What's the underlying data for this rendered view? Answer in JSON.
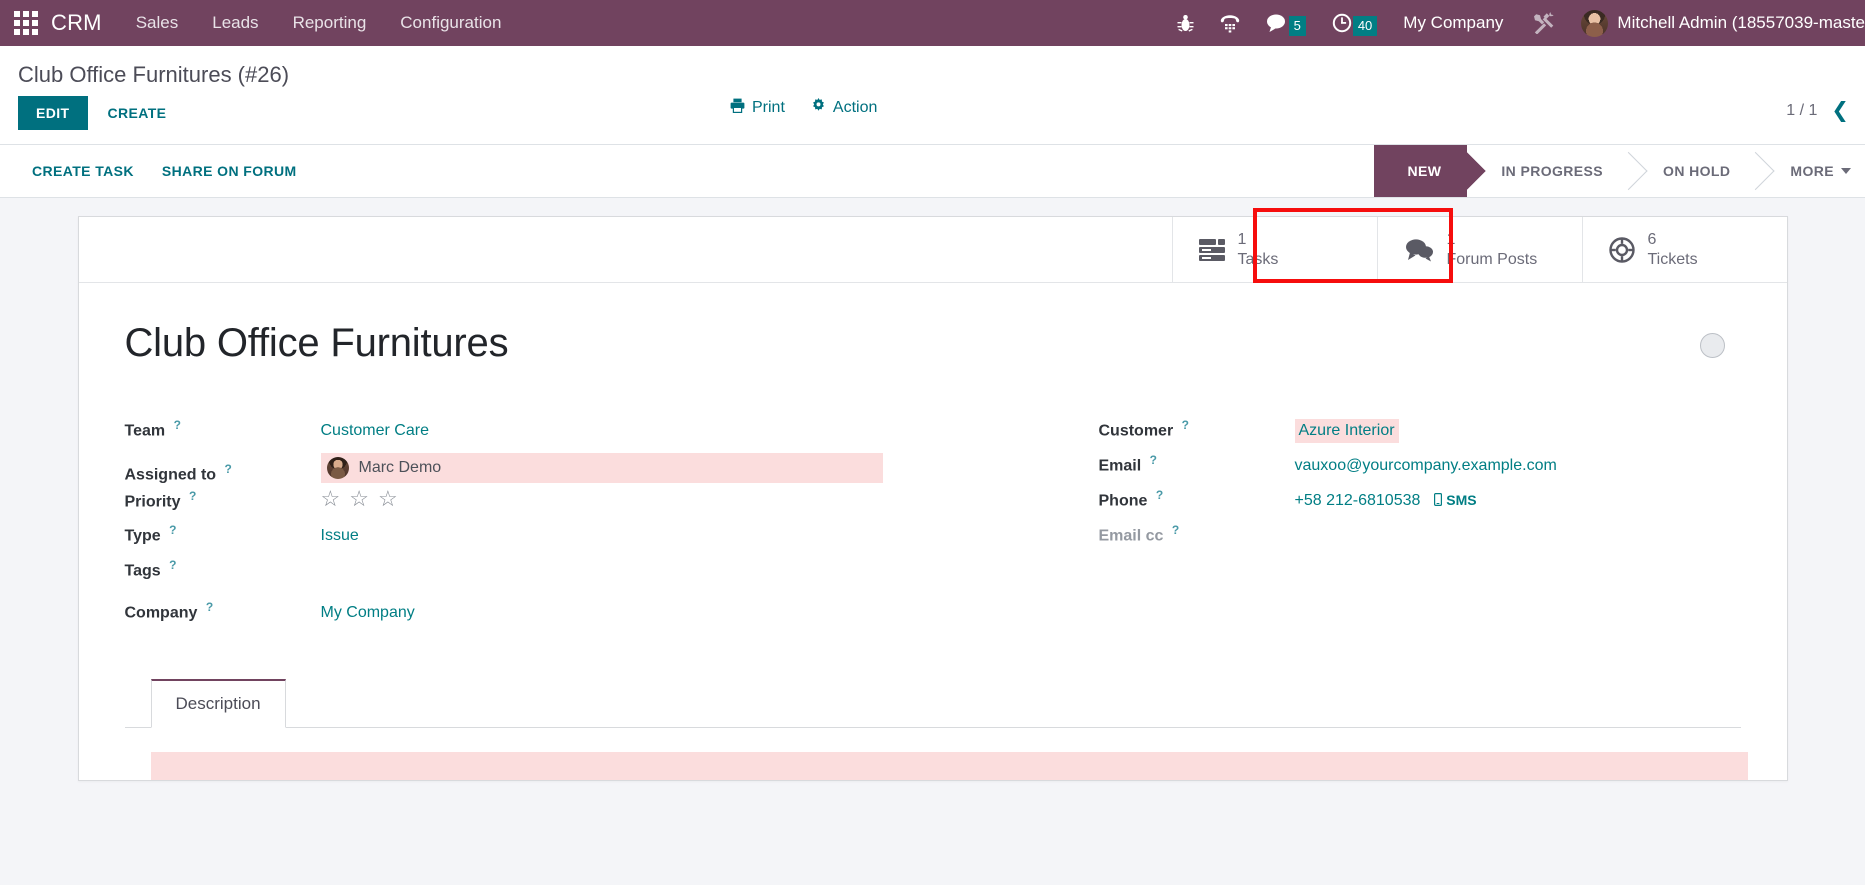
{
  "navbar": {
    "apps_icon": "apps-grid-icon",
    "brand": "CRM",
    "menus": [
      "Sales",
      "Leads",
      "Reporting",
      "Configuration"
    ],
    "sys_icons": [
      {
        "name": "bug-icon"
      },
      {
        "name": "voip-phone-icon"
      },
      {
        "name": "messages-icon",
        "badge": "5"
      },
      {
        "name": "activities-clock-icon",
        "badge": "40"
      }
    ],
    "company": "My Company",
    "settings_icon": "tools-icon",
    "avatar": "user-avatar",
    "user": "Mitchell Admin (18557039-maste"
  },
  "control_panel": {
    "breadcrumb": "Club Office Furnitures (#26)",
    "edit_label": "EDIT",
    "create_label": "CREATE",
    "print_label": "Print",
    "action_label": "Action",
    "pager": "1 / 1",
    "pager_prev_icon": "chevron-left-icon"
  },
  "status_bar": {
    "buttons": [
      "CREATE TASK",
      "SHARE ON FORUM"
    ],
    "stages": [
      {
        "label": "NEW",
        "active": true
      },
      {
        "label": "IN PROGRESS",
        "active": false
      },
      {
        "label": "ON HOLD",
        "active": false
      },
      {
        "label": "MORE",
        "active": false,
        "caret": true
      }
    ]
  },
  "smart_buttons": [
    {
      "value": "1",
      "label": "Tasks",
      "icon": "list-rows-icon",
      "highlighted": false
    },
    {
      "value": "1",
      "label": "Forum Posts",
      "icon": "comments-icon",
      "highlighted": true
    },
    {
      "value": "6",
      "label": "Tickets",
      "icon": "life-buoy-icon",
      "highlighted": false
    }
  ],
  "form": {
    "title": "Club Office Furnitures",
    "kanban_state_icon": "kanban-state-circle",
    "left_fields": [
      {
        "label": "Team",
        "value": "Customer Care",
        "style": "link"
      },
      {
        "label": "Assigned to",
        "value": "Marc Demo",
        "style": "user-required"
      },
      {
        "label": "Priority",
        "value": "",
        "style": "stars"
      },
      {
        "label": "Type",
        "value": "Issue",
        "style": "link"
      },
      {
        "label": "Tags",
        "value": "",
        "style": "empty"
      },
      {
        "label": "Company",
        "value": "My Company",
        "style": "link"
      }
    ],
    "right_fields": [
      {
        "label": "Customer",
        "value": "Azure Interior",
        "style": "required"
      },
      {
        "label": "Email",
        "value": "vauxoo@yourcompany.example.com",
        "style": "link"
      },
      {
        "label": "Phone",
        "value": "+58 212-6810538",
        "style": "phone",
        "sms_label": "SMS",
        "sms_icon": "mobile-icon"
      },
      {
        "label": "Email cc",
        "value": "",
        "style": "muted"
      }
    ],
    "priority_stars": 3,
    "notebook": {
      "tabs": [
        "Description"
      ],
      "active_tab": "Description",
      "description_value": ""
    }
  },
  "colors": {
    "navbar_purple": "#71435f",
    "accent_teal": "#00707f",
    "required_pink": "#fbdddd",
    "highlight_red": "#f60d0d",
    "badge_teal": "#017e84"
  }
}
